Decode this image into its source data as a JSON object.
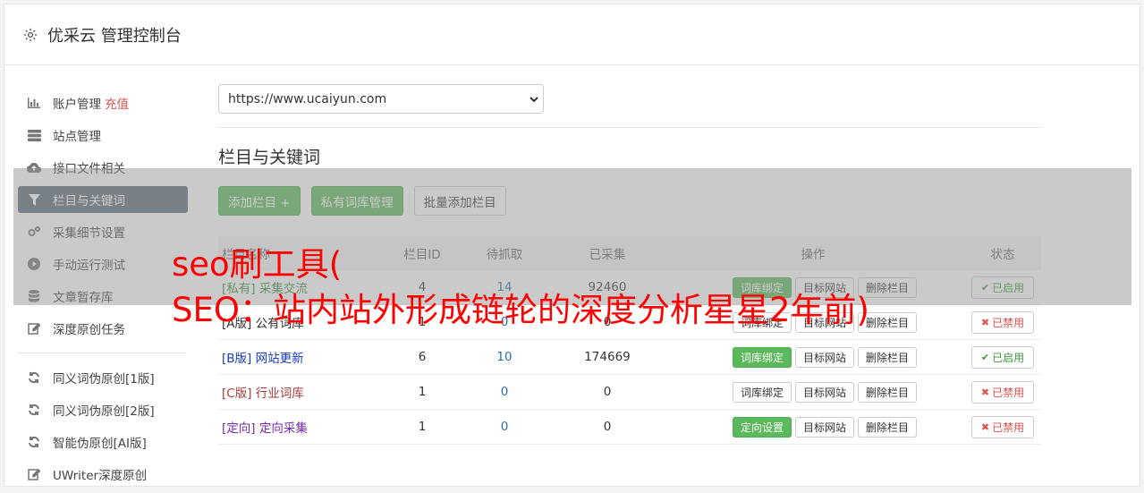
{
  "header": {
    "title": "优采云 管理控制台",
    "icon": "gear-icon"
  },
  "sidebar": {
    "items": [
      {
        "label": "账户管理",
        "badge": "充值",
        "icon": "bar-chart-icon"
      },
      {
        "label": "站点管理",
        "icon": "server-icon"
      },
      {
        "label": "接口文件相关",
        "icon": "cloud-upload-icon"
      },
      {
        "label": "栏目与关键词",
        "icon": "filter-icon",
        "active": true
      },
      {
        "label": "采集细节设置",
        "icon": "cogs-icon"
      },
      {
        "label": "手动运行测试",
        "icon": "play-circle-icon"
      },
      {
        "label": "文章暂存库",
        "icon": "database-icon"
      },
      {
        "label": "深度原创任务",
        "icon": "edit-icon"
      }
    ],
    "items2": [
      {
        "label": "同义词伪原创[1版]",
        "icon": "refresh-icon"
      },
      {
        "label": "同义词伪原创[2版]",
        "icon": "refresh-icon"
      },
      {
        "label": "智能伪原创[AI版]",
        "icon": "refresh-icon"
      },
      {
        "label": "UWriter深度原创",
        "icon": "edit-icon"
      }
    ]
  },
  "main": {
    "site_select": "https://www.ucaiyun.com",
    "section_title": "栏目与关键词",
    "buttons": {
      "add_column": "添加栏目 +",
      "private_lib": "私有词库管理",
      "batch_add": "批量添加栏目"
    },
    "table": {
      "headers": {
        "name": "栏目名称",
        "id": "栏目ID",
        "wait": "待抓取",
        "done": "已采集",
        "ops": "操作",
        "status": "状态"
      },
      "rows": [
        {
          "tag": "[私有]",
          "name": "采集交流",
          "id": "4",
          "wait": "14",
          "done": "92460",
          "op1": "词库绑定",
          "op2": "目标网站",
          "op3": "删除栏目",
          "status": "已启用",
          "on": true,
          "color": "#3c8a3c",
          "op1_green": true
        },
        {
          "tag": "[A版]",
          "name": "公有词库",
          "id": "1",
          "wait": "0",
          "done": "0",
          "op1": "词库绑定",
          "op2": "目标网站",
          "op3": "删除栏目",
          "status": "已禁用",
          "on": false,
          "color": "#333333",
          "op1_green": false
        },
        {
          "tag": "[B版]",
          "name": "网站更新",
          "id": "6",
          "wait": "10",
          "done": "174669",
          "op1": "词库绑定",
          "op2": "目标网站",
          "op3": "删除栏目",
          "status": "已启用",
          "on": true,
          "color": "#1a3bbf",
          "op1_green": true
        },
        {
          "tag": "[C版]",
          "name": "行业词库",
          "id": "1",
          "wait": "0",
          "done": "0",
          "op1": "词库绑定",
          "op2": "目标网站",
          "op3": "删除栏目",
          "status": "已禁用",
          "on": false,
          "color": "#a83a3a",
          "op1_green": false
        },
        {
          "tag": "[定向]",
          "name": "定向采集",
          "id": "1",
          "wait": "0",
          "done": "0",
          "op1": "定向设置",
          "op2": "目标网站",
          "op3": "删除栏目",
          "status": "已禁用",
          "on": false,
          "color": "#7a2ab0",
          "op1_green": true
        }
      ]
    }
  },
  "watermark": {
    "line1": "seo刷工具(",
    "line2": "SEO：站内站外形成链轮的深度分析星星2年前)"
  },
  "colors": {
    "green": "#5cb85c",
    "red": "#d9534f",
    "active_nav": "#5b6b7b"
  }
}
